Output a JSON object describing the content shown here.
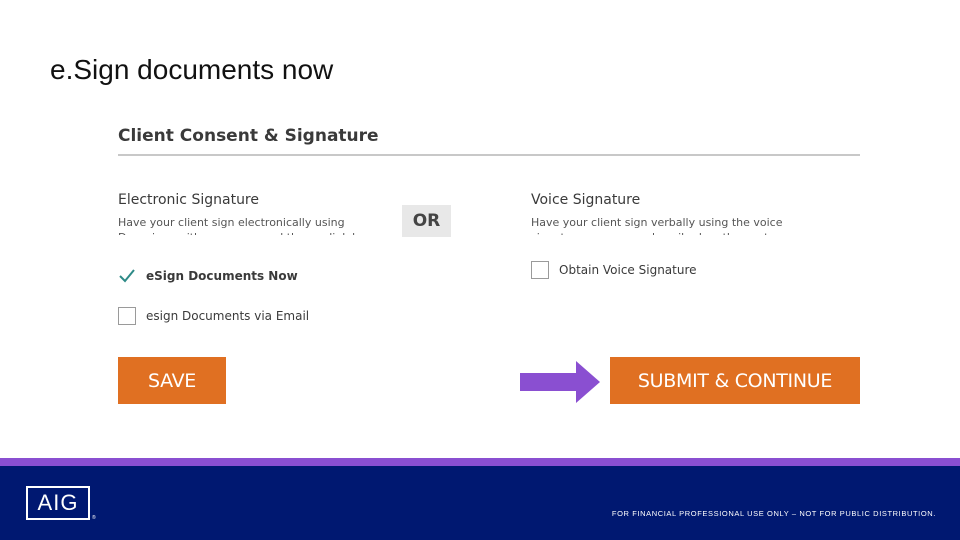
{
  "slide": {
    "title": "e.Sign documents now"
  },
  "form": {
    "heading": "Client Consent & Signature",
    "electronic": {
      "title": "Electronic Signature",
      "description": "Have your client sign electronically using Docusign - either now or send them a link by email.",
      "options": [
        {
          "label": "eSign Documents Now",
          "checked": true
        },
        {
          "label": "esign Documents via Email",
          "checked": false
        }
      ]
    },
    "or_label": "OR",
    "voice": {
      "title": "Voice Signature",
      "description": "Have your client sign verbally using the voice signature process as described on the next screens.",
      "options": [
        {
          "label": "Obtain Voice Signature",
          "checked": false
        }
      ]
    },
    "save_label": "SAVE",
    "submit_label": "SUBMIT & CONTINUE"
  },
  "footer": {
    "logo_text": "AIG",
    "logo_mark": "®",
    "disclaimer": "FOR FINANCIAL PROFESSIONAL USE ONLY – NOT FOR PUBLIC DISTRIBUTION."
  },
  "colors": {
    "accent_orange": "#e07022",
    "arrow_purple": "#8a4fd1",
    "footer_navy": "#001871",
    "check_teal": "#2e8a87"
  },
  "icons": {
    "check": "checkmark-icon",
    "arrow": "right-arrow-icon"
  }
}
